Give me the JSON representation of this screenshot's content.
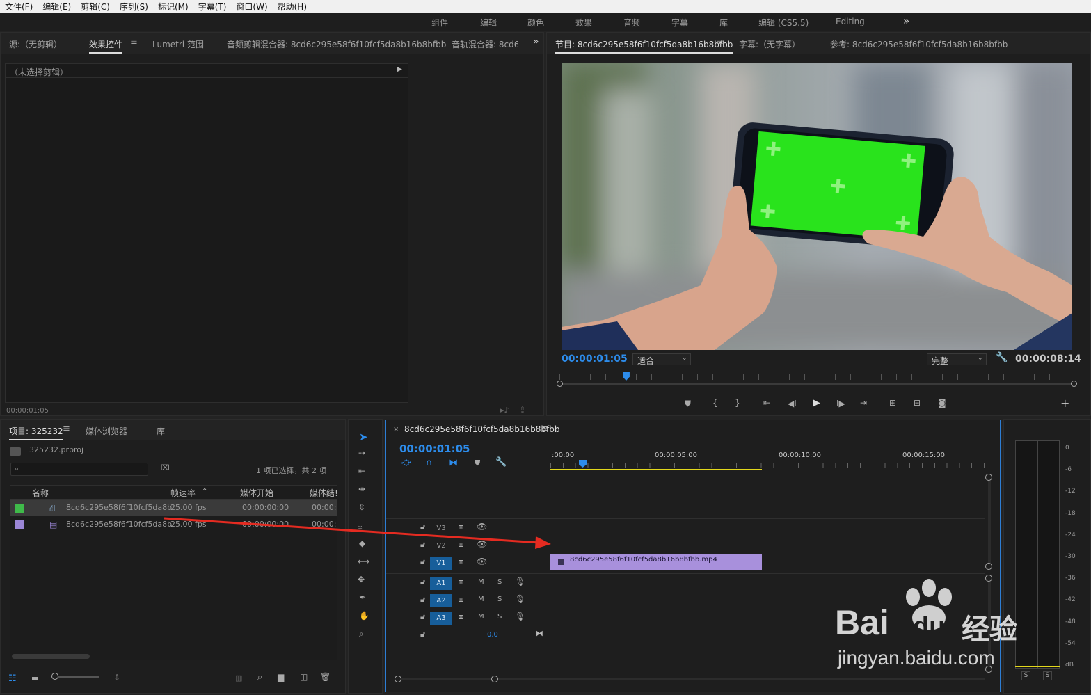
{
  "menu": [
    "文件(F)",
    "编辑(E)",
    "剪辑(C)",
    "序列(S)",
    "标记(M)",
    "字幕(T)",
    "窗口(W)",
    "帮助(H)"
  ],
  "workspaces": [
    "组件",
    "编辑",
    "颜色",
    "效果",
    "音频",
    "字幕",
    "库",
    "编辑 (CS5.5)",
    "Editing"
  ],
  "workspace_more": "»",
  "source_panel": {
    "tabs": [
      "源:（无剪辑）",
      "效果控件",
      "Lumetri 范围",
      "音频剪辑混合器: 8cd6c295e58f6f10fcf5da8b16b8bfbb",
      "音轨混合器: 8cd6"
    ],
    "active_tab": "效果控件",
    "no_clip": "（未选择剪辑）",
    "timecode": "00:00:01:05"
  },
  "program_monitor": {
    "tabs": [
      "节目: 8cd6c295e58f6f10fcf5da8b16b8bfbb",
      "字幕:（无字幕）",
      "参考: 8cd6c295e58f6f10fcf5da8b16b8bfbb"
    ],
    "timecode": "00:00:01:05",
    "fit": "适合",
    "quality": "完整",
    "duration": "00:00:08:14",
    "playhead_fraction": 0.13
  },
  "project_panel": {
    "tabs": [
      "项目: 325232",
      "媒体浏览器",
      "库"
    ],
    "file": "325232.prproj",
    "selection_info": "1 项已选择，共 2 项",
    "columns": [
      "名称",
      "帧速率",
      "媒体开始",
      "媒体结!"
    ],
    "rows": [
      {
        "color": "#3fba4a",
        "icon": "sequence-icon",
        "name": "8cd6c295e58f6f10fcf5da8b",
        "fps": "25.00 fps",
        "start": "00:00:00:00",
        "end": "00:00:0"
      },
      {
        "color": "#9b86d6",
        "icon": "video-clip-icon",
        "name": "8cd6c295e58f6f10fcf5da8b",
        "fps": "25.00 fps",
        "start": "00:00:00:00",
        "end": "00:00:0"
      }
    ]
  },
  "timeline": {
    "sequence_name": "8cd6c295e58f6f10fcf5da8b16b8bfbb",
    "timecode": "00:00:01:05",
    "ruler": [
      ":00:00",
      "00:00:05:00",
      "00:00:10:00",
      "00:00:15:00"
    ],
    "video_tracks": [
      "V3",
      "V2",
      "V1"
    ],
    "audio_tracks": [
      "A1",
      "A2",
      "A3"
    ],
    "mute": "M",
    "solo": "S",
    "master_volume": "0.0",
    "clip_name": "8cd6c295e58f6f10fcf5da8b16b8bfbb.mp4"
  },
  "audio_meter": {
    "scale": [
      "0",
      "-6",
      "-12",
      "-18",
      "-24",
      "-30",
      "-36",
      "-42",
      "-48",
      "-54",
      "dB"
    ],
    "solo_buttons": [
      "S",
      "S"
    ]
  },
  "watermark": {
    "brand": "Bai",
    "brand2": "du",
    "cn": "经验",
    "url": "jingyan.baidu.com"
  },
  "colors": {
    "accent": "#2d8ceb",
    "clip": "#a890dc",
    "track_on": "#175e9a",
    "work_area": "#e3d81c",
    "arrow": "#e52b21",
    "green_screen": "#29e31c"
  }
}
